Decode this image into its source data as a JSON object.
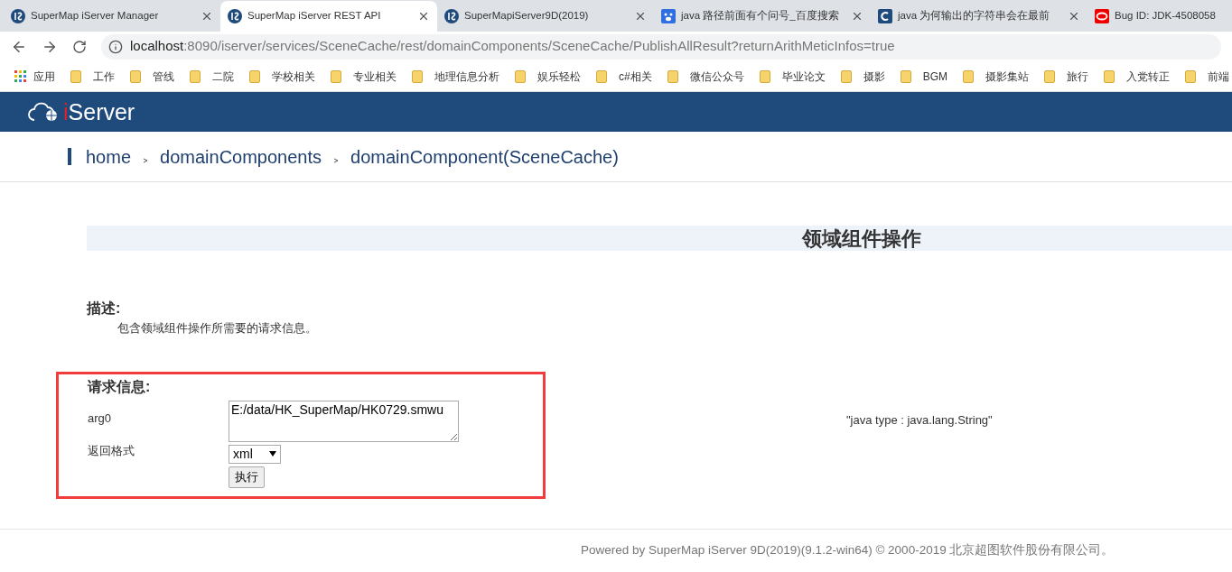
{
  "browser": {
    "tabs": [
      {
        "title": "SuperMap iServer Manager",
        "selected": false
      },
      {
        "title": "SuperMap iServer REST API",
        "selected": true
      },
      {
        "title": "SuperMapiServer9D(2019)",
        "selected": false
      },
      {
        "title": "java 路径前面有个问号_百度搜索",
        "selected": false
      },
      {
        "title": "java 为何输出的字符串会在最前",
        "selected": false
      },
      {
        "title": "Bug ID: JDK-4508058",
        "selected": false
      }
    ],
    "url_host": "localhost",
    "url_rest": ":8090/iserver/services/SceneCache/rest/domainComponents/SceneCache/PublishAllResult?returnArithMeticInfos=true",
    "apps_label": "应用",
    "bookmarks": [
      "工作",
      "管线",
      "二院",
      "学校相关",
      "专业相关",
      "地理信息分析",
      "娱乐轻松",
      "c#相关",
      "微信公众号",
      "毕业论文",
      "摄影",
      "BGM",
      "摄影集站",
      "旅行",
      "入党转正",
      "前端"
    ]
  },
  "header": {
    "logo": "iServer"
  },
  "breadcrumbs": [
    "home",
    "domainComponents",
    "domainComponent(SceneCache)"
  ],
  "page_title": "领域组件操作",
  "description": {
    "heading": "描述:",
    "text": "包含领域组件操作所需要的请求信息。"
  },
  "request": {
    "heading": "请求信息:",
    "arg_label": "arg0",
    "arg_value": "E:/data/HK_SuperMap/HK0729.smwu",
    "arg_type": "\"java type : java.lang.String\"",
    "format_label": "返回格式",
    "format_value": "xml",
    "submit": "执行"
  },
  "footer": "Powered by SuperMap iServer 9D(2019)(9.1.2-win64) © 2000-2019 北京超图软件股份有限公司。"
}
